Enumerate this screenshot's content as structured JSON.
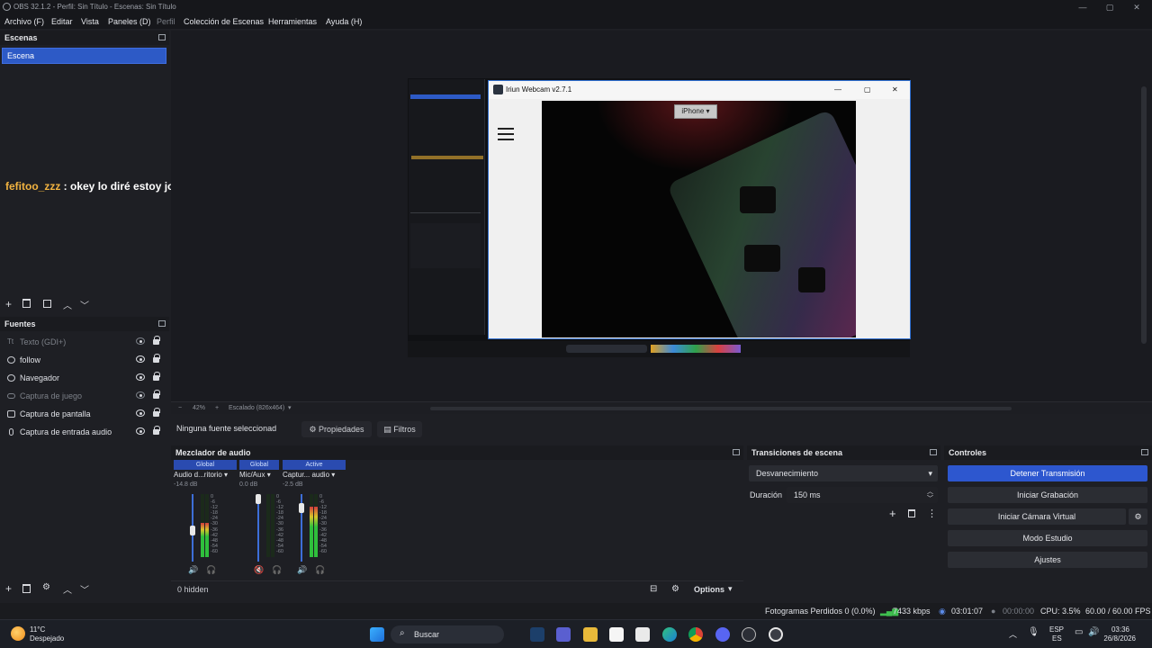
{
  "window": {
    "title": "OBS 32.1.2 - Perfil: Sin Título - Escenas: Sin Título",
    "controls": {
      "minimize": "—",
      "maximize": "▢",
      "close": "✕"
    }
  },
  "menu": [
    "Archivo (F)",
    "Editar",
    "Vista",
    "Paneles (D)",
    "Perfil",
    "Colección de Escenas",
    "Herramientas",
    "Ayuda (H)"
  ],
  "scenes": {
    "title": "Escenas",
    "items": [
      "Escena"
    ]
  },
  "chat_overlay": {
    "user": "fefitoo_zzz",
    "message": " : okey lo diré estoy joseadito"
  },
  "sources": {
    "title": "Fuentes",
    "items": [
      {
        "label": "Texto (GDI+)",
        "visible": false,
        "icon": "text-icon"
      },
      {
        "label": "follow",
        "visible": true,
        "icon": "globe-icon"
      },
      {
        "label": "Navegador",
        "visible": true,
        "icon": "globe-icon"
      },
      {
        "label": "Captura de juego",
        "visible": false,
        "icon": "gamepad-icon"
      },
      {
        "label": "Captura de pantalla",
        "visible": true,
        "icon": "monitor-icon"
      },
      {
        "label": "Captura de entrada audio",
        "visible": true,
        "icon": "microphone-icon"
      }
    ]
  },
  "iriun": {
    "title": "Iriun Webcam v2.7.1",
    "device": "iPhone",
    "window_controls": {
      "minimize": "—",
      "maximize": "▢",
      "close": "✕"
    }
  },
  "preview_toolbar": {
    "zoom": "42%",
    "scale_label": "Escalado (826x464)"
  },
  "properties_bar": {
    "no_source": "Ninguna fuente seleccionad",
    "properties_label": "Propiedades",
    "filters_label": "Filtros"
  },
  "audio_mixer": {
    "title": "Mezclador de audio",
    "channels": [
      {
        "tag": "Global",
        "name": "Audio d...ritorio",
        "db": "-14.8 dB",
        "level": 0.55,
        "fader": 0.45,
        "muted": false
      },
      {
        "tag": "Global",
        "name": "Mic/Aux",
        "db": "0.0 dB",
        "level": 0.0,
        "fader": 1.0,
        "muted": true
      },
      {
        "tag": "Active",
        "name": "Captur... audio",
        "db": "-2.5 dB",
        "level": 0.8,
        "fader": 0.85,
        "muted": false
      }
    ],
    "scale": [
      "0",
      "-6",
      "-12",
      "-18",
      "-24",
      "-30",
      "-36",
      "-42",
      "-48",
      "-54",
      "-60"
    ],
    "hidden_label": "0 hidden",
    "options_label": "Options"
  },
  "transitions": {
    "title": "Transiciones de escena",
    "selected": "Desvanecimiento",
    "duration_label": "Duración",
    "duration_value": "150 ms"
  },
  "controls": {
    "title": "Controles",
    "buttons": [
      "Detener Transmisión",
      "Iniciar Grabación",
      "Iniciar Cámara Virtual",
      "Modo Estudio",
      "Ajustes"
    ]
  },
  "status": {
    "dropped": "Fotogramas Perdidos 0 (0.0%)",
    "bitrate": "7433 kbps",
    "stream_time": "03:01:07",
    "rec_time": "00:00:00",
    "cpu": "CPU: 3.5%",
    "fps": "60.00 / 60.00 FPS"
  },
  "taskbar": {
    "weather_temp": "11°C",
    "weather_desc": "Despejado",
    "search": "Buscar",
    "lang1": "ESP",
    "lang2": "ES",
    "time": "03:36",
    "date": "26/8/2026"
  },
  "colors": {
    "accent": "#2d57cf",
    "chat_user": "#f2b340",
    "meter_green": "#2fbf3c"
  }
}
